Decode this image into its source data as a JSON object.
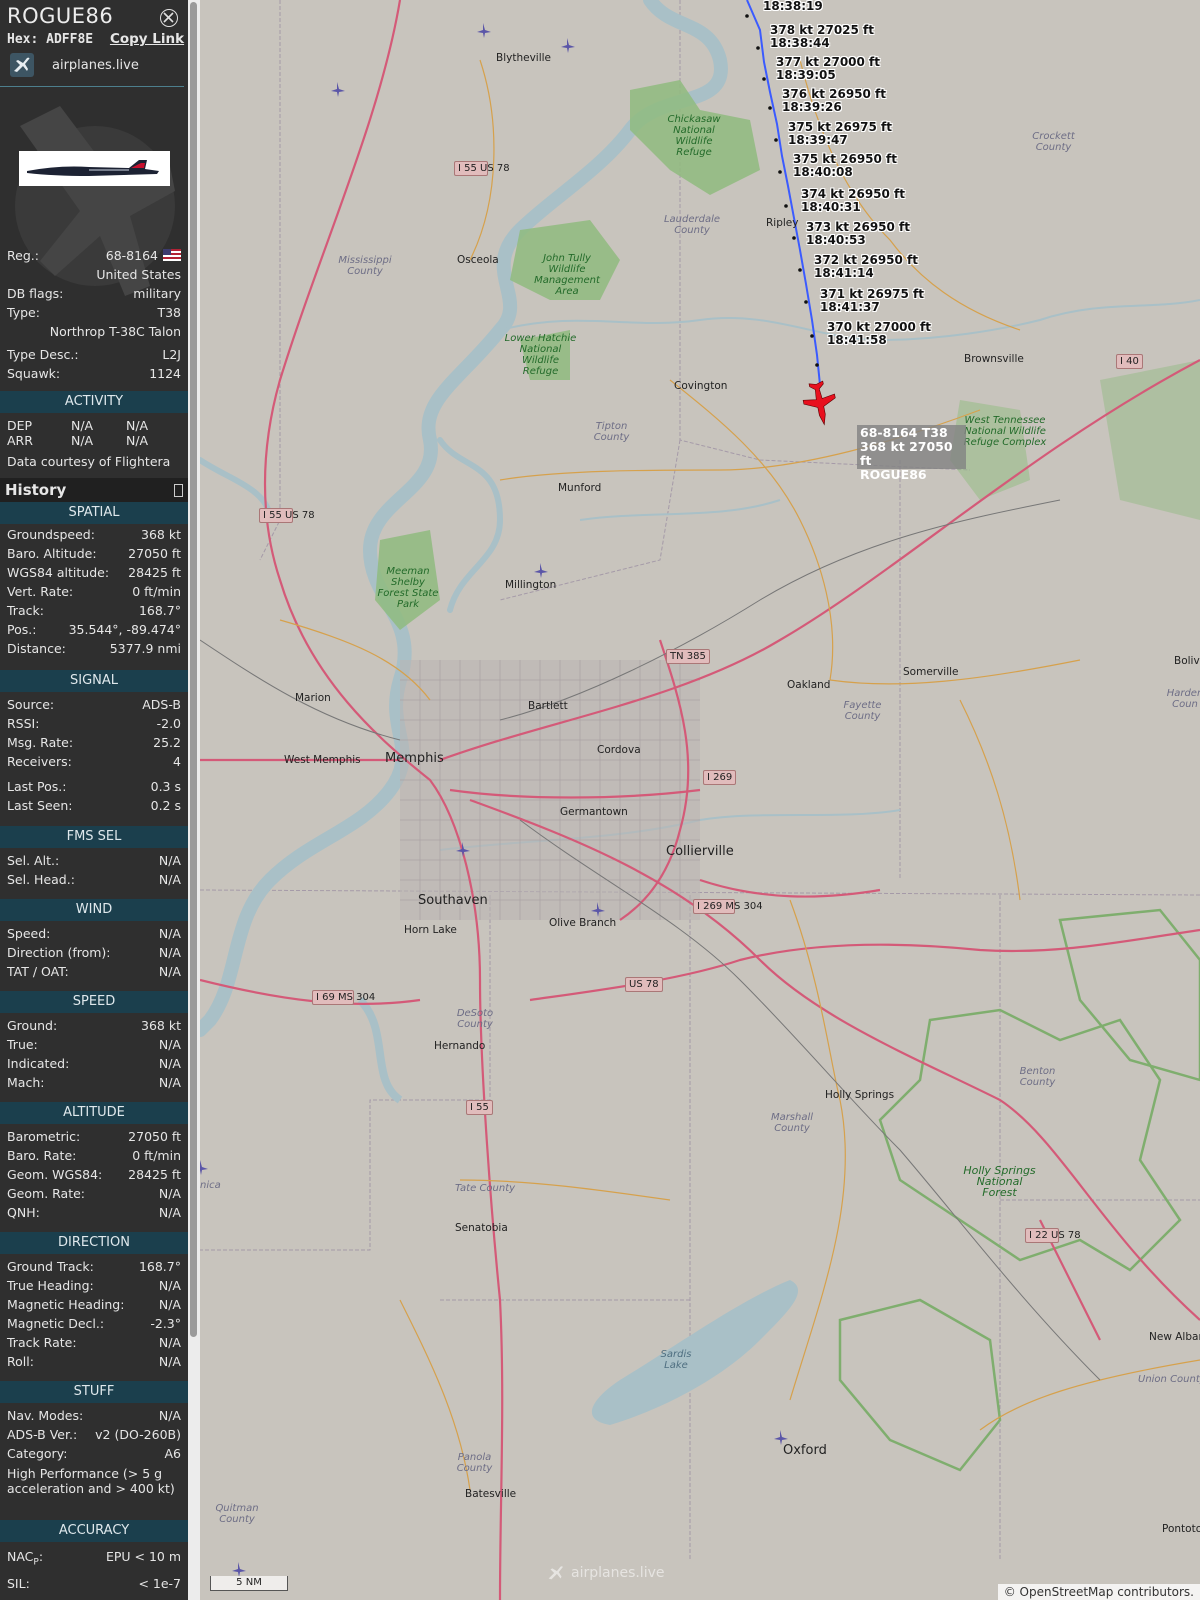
{
  "header": {
    "callsign": "ROGUE86",
    "hex_label": "Hex:",
    "hex": "ADFF8E",
    "copy_link": "Copy Link",
    "source_name": "airplanes.live"
  },
  "info": {
    "reg_label": "Reg.:",
    "reg": "68-8164",
    "country": "United States",
    "dbflags_label": "DB flags:",
    "dbflags": "military",
    "type_label": "Type:",
    "type": "T38",
    "type_name": "Northrop T-38C Talon",
    "typedesc_label": "Type Desc.:",
    "typedesc": "L2J",
    "squawk_label": "Squawk:",
    "squawk": "1124"
  },
  "activity": {
    "title": "ACTIVITY",
    "dep_label": "DEP",
    "dep_1": "N/A",
    "dep_2": "N/A",
    "arr_label": "ARR",
    "arr_1": "N/A",
    "arr_2": "N/A",
    "courtesy": "Data courtesy of",
    "courtesy_src": "Flightera"
  },
  "history": {
    "label": "History"
  },
  "spatial": {
    "title": "SPATIAL",
    "rows": [
      [
        "Groundspeed:",
        "368 kt"
      ],
      [
        "Baro. Altitude:",
        "27050 ft"
      ],
      [
        "WGS84 altitude:",
        "28425 ft"
      ],
      [
        "Vert. Rate:",
        "0 ft/min"
      ],
      [
        "Track:",
        "168.7°"
      ],
      [
        "Pos.:",
        "35.544°, -89.474°"
      ],
      [
        "Distance:",
        "5377.9 nmi"
      ]
    ]
  },
  "signal": {
    "title": "SIGNAL",
    "rows": [
      [
        "Source:",
        "ADS-B"
      ],
      [
        "RSSI:",
        "-2.0"
      ],
      [
        "Msg. Rate:",
        "25.2"
      ],
      [
        "Receivers:",
        "4"
      ],
      [
        "Last Pos.:",
        "0.3 s"
      ],
      [
        "Last Seen:",
        "0.2 s"
      ]
    ]
  },
  "fms": {
    "title": "FMS SEL",
    "rows": [
      [
        "Sel. Alt.:",
        "N/A"
      ],
      [
        "Sel. Head.:",
        "N/A"
      ]
    ]
  },
  "wind": {
    "title": "WIND",
    "rows": [
      [
        "Speed:",
        "N/A"
      ],
      [
        "Direction (from):",
        "N/A"
      ],
      [
        "TAT / OAT:",
        "N/A"
      ]
    ]
  },
  "speed": {
    "title": "SPEED",
    "rows": [
      [
        "Ground:",
        "368 kt"
      ],
      [
        "True:",
        "N/A"
      ],
      [
        "Indicated:",
        "N/A"
      ],
      [
        "Mach:",
        "N/A"
      ]
    ]
  },
  "altitude": {
    "title": "ALTITUDE",
    "rows": [
      [
        "Barometric:",
        "27050 ft"
      ],
      [
        "Baro. Rate:",
        "0 ft/min"
      ],
      [
        "Geom. WGS84:",
        "28425 ft"
      ],
      [
        "Geom. Rate:",
        "N/A"
      ],
      [
        "QNH:",
        "N/A"
      ]
    ]
  },
  "direction": {
    "title": "DIRECTION",
    "rows": [
      [
        "Ground Track:",
        "168.7°"
      ],
      [
        "True Heading:",
        "N/A"
      ],
      [
        "Magnetic Heading:",
        "N/A"
      ],
      [
        "Magnetic Decl.:",
        "-2.3°"
      ],
      [
        "Track Rate:",
        "N/A"
      ],
      [
        "Roll:",
        "N/A"
      ]
    ]
  },
  "stuff": {
    "title": "STUFF",
    "rows": [
      [
        "Nav. Modes:",
        "N/A"
      ],
      [
        "ADS-B Ver.:",
        "v2 (DO-260B)"
      ],
      [
        "Category:",
        "A6"
      ]
    ],
    "category_desc": "High Performance (> 5 g acceleration and > 400 kt)"
  },
  "accuracy": {
    "title": "ACCURACY",
    "nacp_label": "NAC",
    "nacp_sub": "P",
    "nacp_colon": ":",
    "nacp": "EPU < 10 m",
    "sil_label": "SIL:",
    "sil": "< 1e-7"
  },
  "track_labels": [
    {
      "line1": "18:38:19",
      "line2": ""
    },
    {
      "line1": "378 kt  27025 ft",
      "line2": "18:38:44"
    },
    {
      "line1": "377 kt  27000 ft",
      "line2": "18:39:05"
    },
    {
      "line1": "376 kt  26950 ft",
      "line2": "18:39:26"
    },
    {
      "line1": "375 kt  26975 ft",
      "line2": "18:39:47"
    },
    {
      "line1": "375 kt  26950 ft",
      "line2": "18:40:08"
    },
    {
      "line1": "374 kt  26950 ft",
      "line2": "18:40:31"
    },
    {
      "line1": "373 kt  26950 ft",
      "line2": "18:40:53"
    },
    {
      "line1": "372 kt  26950 ft",
      "line2": "18:41:14"
    },
    {
      "line1": "371 kt  26975 ft",
      "line2": "18:41:37"
    },
    {
      "line1": "370 kt  27000 ft",
      "line2": "18:41:58"
    }
  ],
  "aircraft_label": {
    "line1": "68-8164 T38",
    "line2": "368 kt  27050 ft",
    "line3": "ROGUE86"
  },
  "map": {
    "scale": "5 NM",
    "attribution_prefix": "©",
    "attribution_link": "OpenStreetMap",
    "attribution_suffix": "contributors.",
    "watermark": "airplanes.live",
    "towns": [
      "Blytheville",
      "Osceola",
      "Covington",
      "Ripley",
      "Brownsville",
      "Munford",
      "Millington",
      "Somerville",
      "Oakland",
      "Bartlett",
      "Cordova",
      "Memphis",
      "West Memphis",
      "Marion",
      "Germantown",
      "Collierville",
      "Southaven",
      "Horn Lake",
      "Olive Branch",
      "Hernando",
      "Holly Springs",
      "Senatobia",
      "Oxford",
      "Batesville",
      "New Albany",
      "Pontotoc",
      "Boliva"
    ],
    "counties": [
      "Crockett County",
      "Lauderdale County",
      "Mississippi County",
      "Tipton County",
      "Fayette County",
      "Harden Coun",
      "DeSoto County",
      "Marshall County",
      "Benton County",
      "Tate County",
      "Panola County",
      "Union County",
      "Quitman County",
      "nica"
    ],
    "parks": [
      "Chickasaw National Wildlife Refuge",
      "John Tully Wildlife Management Area",
      "Lower Hatchie National Wildlife Refuge",
      "Meeman Shelby Forest State Park",
      "West Tennessee National Wildlife Refuge Complex",
      "Holly Springs National Forest",
      "Sardis Lake"
    ],
    "shields": [
      "I 55 US 78",
      "I 55 US 78",
      "TN 385",
      "I 269",
      "I 269 MS 304",
      "I 69 MS 304",
      "US 78",
      "I 55",
      "I 40",
      "I 22 US 78"
    ],
    "colors": {
      "land": "#c8c4bd",
      "water": "#a9c0c7",
      "forest": "#8fbb7f",
      "track": "#3b5bff",
      "aircraft": "#e8101e",
      "section": "#1b3f4d"
    }
  }
}
